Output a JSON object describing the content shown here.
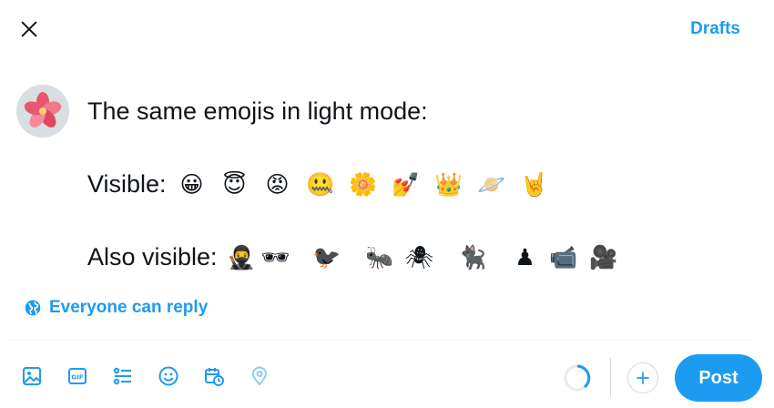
{
  "header": {
    "close_icon": "close-icon",
    "drafts_label": "Drafts"
  },
  "composer": {
    "line1": "The same emojis in light mode:",
    "visible_label": "Visible:",
    "visible_emojis": [
      "😀",
      "😇",
      "😡",
      "🤐",
      "🌼",
      "💅",
      "👑",
      "🪐",
      "🤘"
    ],
    "also_label": "Also visible:",
    "also_emojis": [
      "🥷",
      "🕶",
      "🐦‍⬛",
      "🐜",
      "🕷",
      "🐈‍⬛",
      "♟",
      "📹",
      "🎥"
    ]
  },
  "reply_setting": {
    "label": "Everyone can reply",
    "icon": "globe-icon"
  },
  "toolbar": {
    "icons": [
      "image-icon",
      "gif-icon",
      "poll-icon",
      "emoji-icon",
      "schedule-icon",
      "location-icon"
    ]
  },
  "actions": {
    "add_icon": "plus-icon",
    "post_label": "Post"
  },
  "colors": {
    "accent": "#1d9bf0",
    "text": "#0f1419",
    "divider": "#eff3f4"
  }
}
